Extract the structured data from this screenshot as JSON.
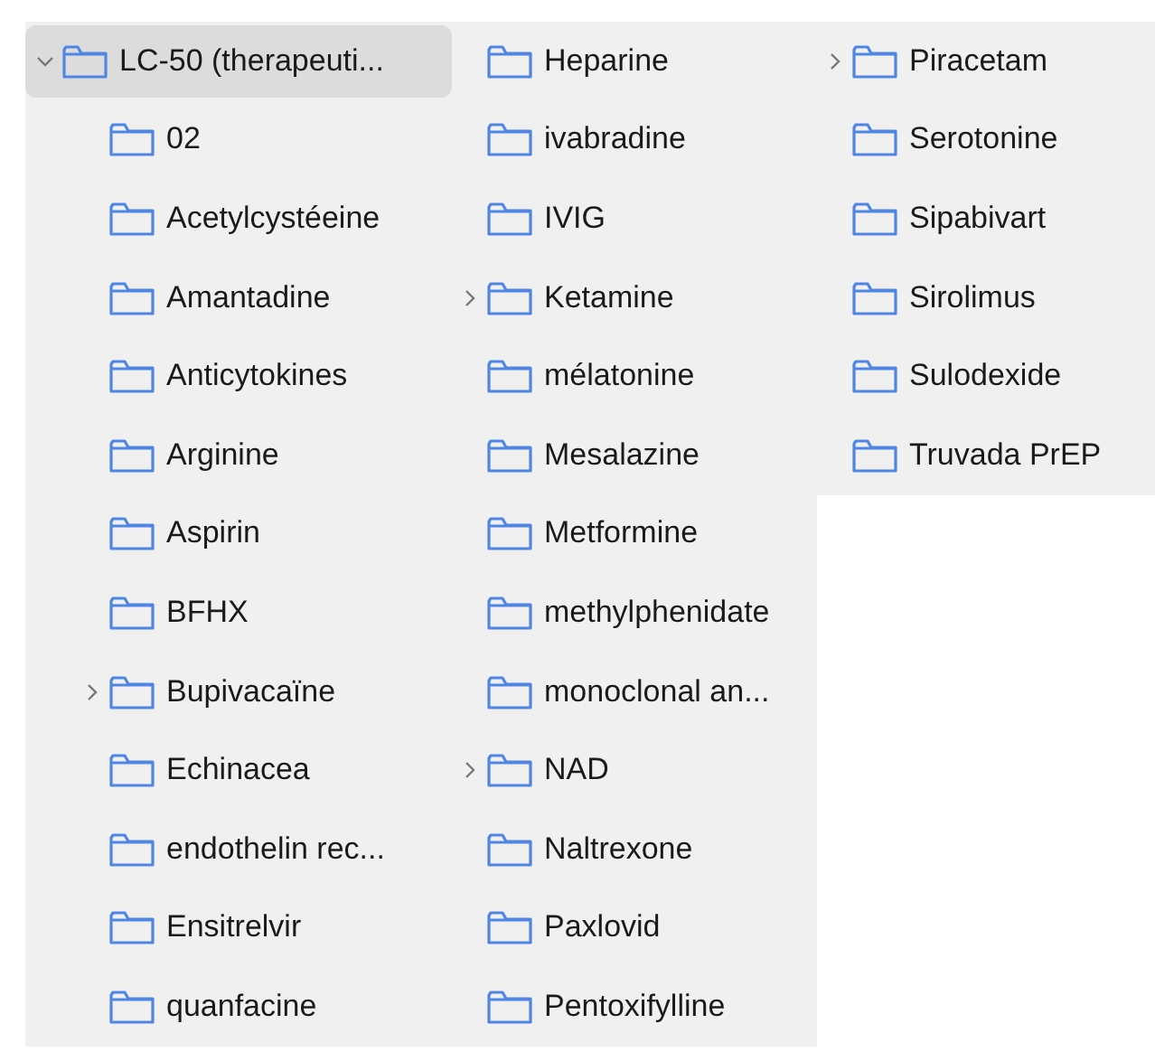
{
  "tree": {
    "label": "LC-50 (therapeuti...",
    "expanded": true,
    "selected": true,
    "children": [
      {
        "label": "02",
        "has_children": false,
        "selected": false
      },
      {
        "label": "Acetylcystéeine",
        "has_children": false,
        "selected": false
      },
      {
        "label": "Amantadine",
        "has_children": false,
        "selected": false
      },
      {
        "label": "Anticytokines",
        "has_children": false,
        "selected": false
      },
      {
        "label": "Arginine",
        "has_children": false,
        "selected": false
      },
      {
        "label": "Aspirin",
        "has_children": false,
        "selected": false
      },
      {
        "label": "BFHX",
        "has_children": false,
        "selected": false
      },
      {
        "label": "Bupivacaïne",
        "has_children": true,
        "selected": false
      },
      {
        "label": "Echinacea",
        "has_children": false,
        "selected": false
      },
      {
        "label": "endothelin rec...",
        "has_children": false,
        "selected": false
      },
      {
        "label": "Ensitrelvir",
        "has_children": false,
        "selected": false
      },
      {
        "label": "quanfacine",
        "has_children": false,
        "selected": false
      },
      {
        "label": "Heparine",
        "has_children": false,
        "selected": false
      },
      {
        "label": "ivabradine",
        "has_children": false,
        "selected": false
      },
      {
        "label": "IVIG",
        "has_children": false,
        "selected": false
      },
      {
        "label": "Ketamine",
        "has_children": true,
        "selected": false
      },
      {
        "label": "mélatonine",
        "has_children": false,
        "selected": false
      },
      {
        "label": "Mesalazine",
        "has_children": false,
        "selected": false
      },
      {
        "label": "Metformine",
        "has_children": false,
        "selected": false
      },
      {
        "label": "methylphenidate",
        "has_children": false,
        "selected": false
      },
      {
        "label": "monoclonal an...",
        "has_children": false,
        "selected": false
      },
      {
        "label": "NAD",
        "has_children": true,
        "selected": false
      },
      {
        "label": "Naltrexone",
        "has_children": false,
        "selected": false
      },
      {
        "label": "Paxlovid",
        "has_children": false,
        "selected": false
      },
      {
        "label": "Pentoxifylline",
        "has_children": false,
        "selected": false
      },
      {
        "label": "Piracetam",
        "has_children": true,
        "selected": false
      },
      {
        "label": "Serotonine",
        "has_children": false,
        "selected": false
      },
      {
        "label": "Sipabivart",
        "has_children": false,
        "selected": false
      },
      {
        "label": "Sirolimus",
        "has_children": false,
        "selected": false
      },
      {
        "label": "Sulodexide",
        "has_children": false,
        "selected": false
      },
      {
        "label": "Truvada PrEP",
        "has_children": false,
        "selected": false
      }
    ]
  }
}
